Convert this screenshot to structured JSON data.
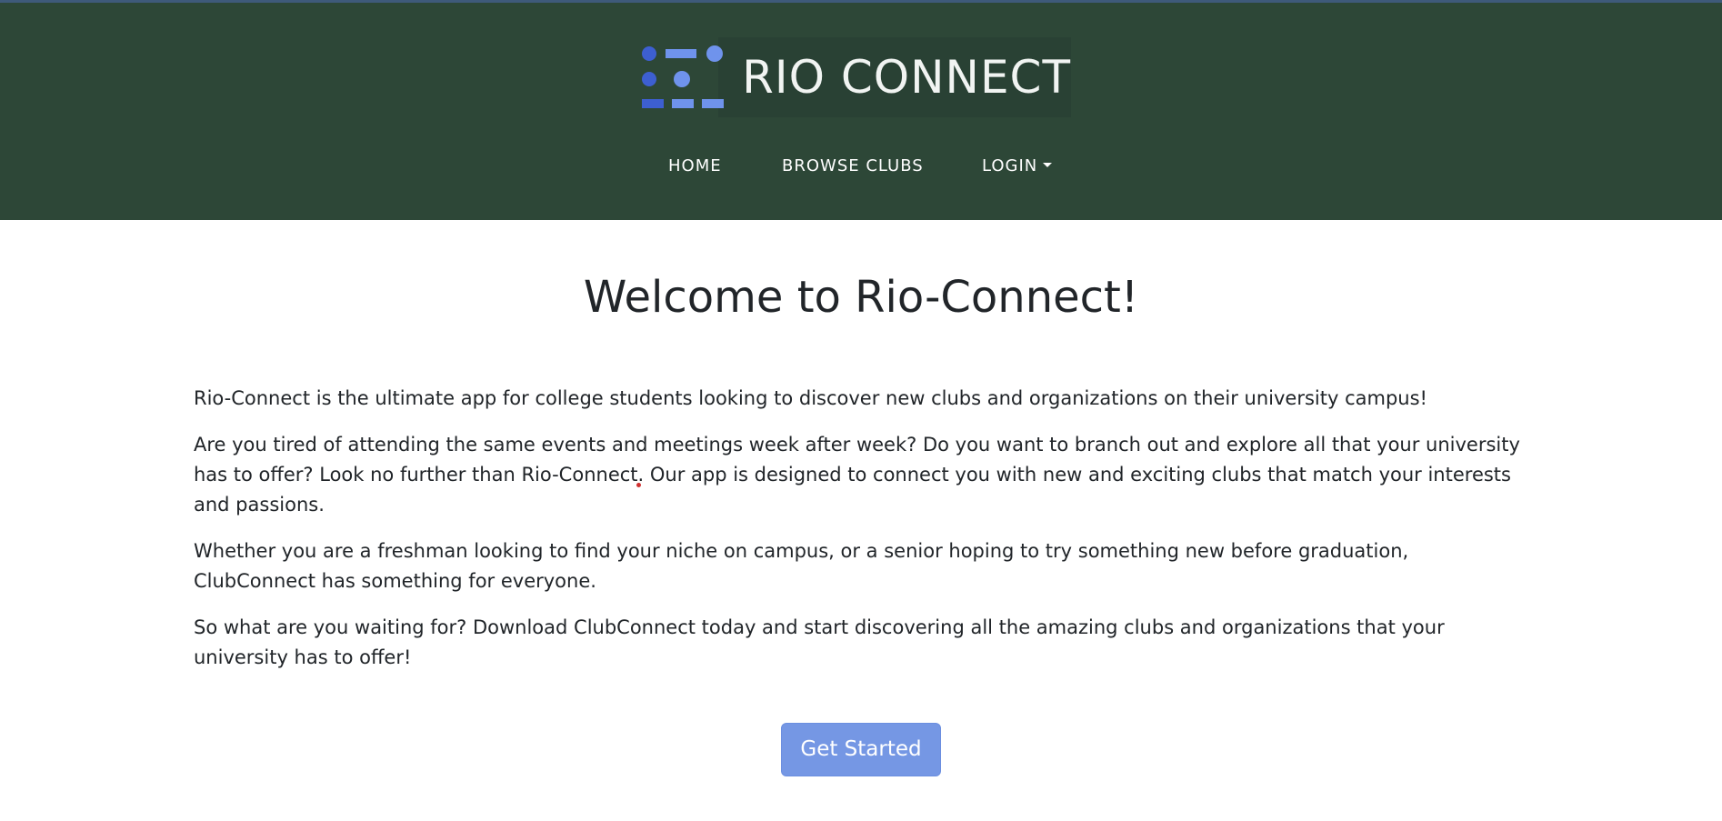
{
  "header": {
    "logo_text": "RIO CONNECT",
    "logo_colors": {
      "dark_blue": "#3d5fd1",
      "light_blue": "#6f93ec"
    },
    "nav": {
      "home": "HOME",
      "browse": "BROWSE CLUBS",
      "login": "LOGIN"
    }
  },
  "main": {
    "title": "Welcome to Rio-Connect!",
    "paragraphs": [
      "Rio-Connect is the ultimate app for college students looking to discover new clubs and organizations on their university campus!",
      "Are you tired of attending the same events and meetings week after week? Do you want to branch out and explore all that your university has to offer? Look no further than Rio-Connect. Our app is designed to connect you with new and exciting clubs that match your interests and passions.",
      "Whether you are a freshman looking to find your niche on campus, or a senior hoping to try something new before graduation, ClubConnect has something for everyone.",
      "So what are you waiting for? Download ClubConnect today and start discovering all the amazing clubs and organizations that your university has to offer!"
    ],
    "cta_label": "Get Started"
  },
  "colors": {
    "header_bg": "#2d4737",
    "button_bg": "#7597e4",
    "text": "#212529"
  }
}
